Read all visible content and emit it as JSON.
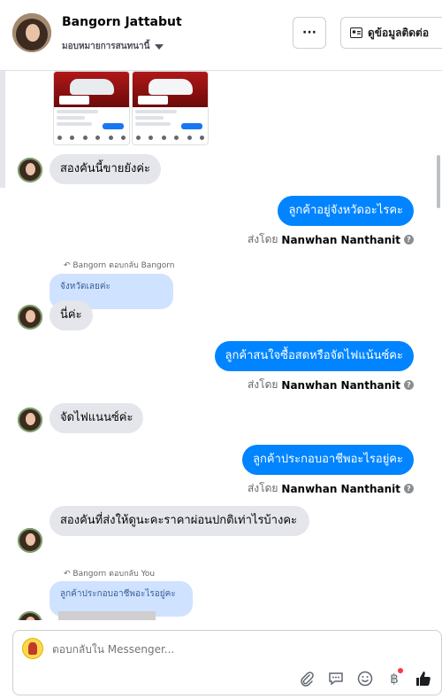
{
  "header": {
    "name": "Bangorn Jattabut",
    "assign_label": "มอบหมายการสนทนานี้",
    "more_label": "···",
    "contact_label": "ดูข้อมูลติดต่อ"
  },
  "messages": [
    {
      "type": "in",
      "text": "สองคันนี้ขายยังค่ะ"
    },
    {
      "type": "out",
      "text": "ลูกค้าอยู่จังหวัดอะไรคะ",
      "sent_by_prefix": "ส่งโดย",
      "sent_by_name": "Nanwhan Nanthanit"
    },
    {
      "type": "reply_label",
      "text": "Bangorn ตอบกลับ Bangorn"
    },
    {
      "type": "quote",
      "text": "จังหวัดเลยค่ะ"
    },
    {
      "type": "in",
      "text": "นี่ค่ะ"
    },
    {
      "type": "out",
      "text": "ลูกค้าสนใจซื้อสดหรือจัดไฟแน้นซ์คะ",
      "sent_by_prefix": "ส่งโดย",
      "sent_by_name": "Nanwhan Nanthanit"
    },
    {
      "type": "in",
      "text": "จัดไฟแนนซ์ค่ะ"
    },
    {
      "type": "out",
      "text": "ลูกค้าประกอบอาชีพอะไรอยู่คะ",
      "sent_by_prefix": "ส่งโดย",
      "sent_by_name": "Nanwhan Nanthanit"
    },
    {
      "type": "in",
      "text": "สองคันที่ส่งให้ดูนะคะราคาผ่อนปกติเท่าไรบ้างคะ"
    },
    {
      "type": "reply_label",
      "text": "Bangorn ตอบกลับ You"
    },
    {
      "type": "quote",
      "text": "ลูกค้าประกอบอาชีพอะไรอยู่คะ"
    }
  ],
  "composer": {
    "placeholder": "ตอบกลับใน Messenger..."
  },
  "tools": [
    "paperclip-icon",
    "saved-reply-icon",
    "emoji-icon",
    "baht-icon",
    "thumbs-up-icon"
  ],
  "colors": {
    "outgoing": "#0084ff",
    "incoming": "#e4e6eb",
    "quote": "#cfe2ff"
  }
}
